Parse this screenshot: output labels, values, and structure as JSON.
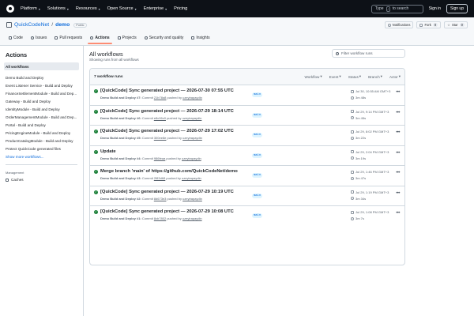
{
  "header": {
    "nav": [
      "Platform",
      "Solutions",
      "Resources",
      "Open Source",
      "Enterprise",
      "Pricing"
    ],
    "search_text": "Type",
    "search_kbd": "/",
    "search_suffix": "to search",
    "sign_in": "Sign in",
    "sign_up": "Sign up"
  },
  "repo": {
    "owner": "QuickCodeNet",
    "separator": "/",
    "name": "demo",
    "visibility": "Public",
    "notifications": "Notifications",
    "fork_label": "Fork",
    "fork_count": "0",
    "star_label": "Star",
    "star_count": "0",
    "tabs": [
      "Code",
      "Issues",
      "Pull requests",
      "Actions",
      "Projects",
      "Security and quality",
      "Insights"
    ]
  },
  "sidebar": {
    "title": "Actions",
    "all_workflows": "All workflows",
    "workflows": [
      "Demo Build and Deploy",
      "Event Listener Service - Build and Deploy",
      "FinanceSettlementModule - Build and Dep...",
      "Gateway - Build and Deploy",
      "IdentityModule - Build and Deploy",
      "OrderManagementModule - Build and Dep...",
      "Portal - Build and Deploy",
      "PricingEngineModule - Build and Deploy",
      "ProductCatalogModule - Build and Deploy",
      "Protect QuickCode generated files"
    ],
    "show_more": "Show more workflows...",
    "management_title": "Management",
    "caches": "Caches"
  },
  "main": {
    "title": "All workflows",
    "subtitle": "Showing runs from all workflows",
    "filter_placeholder": "Filter workflow runs",
    "runs_count": "7 workflow runs",
    "filters": [
      "Workflow",
      "Event",
      "Status",
      "Branch",
      "Actor"
    ],
    "runs": [
      {
        "title": "[QuickCode] Sync generated project — 2026-07-30 07:55 UTC",
        "workflow": "Demo Build and Deploy #7:",
        "commit_prefix": "Commit",
        "commit": "21b78a8",
        "pushed_by": "pushed by",
        "actor": "uzeyirapaydin",
        "branch": "main",
        "time": "Jul 30, 10:55 AM GMT+3",
        "duration": "3m 48s"
      },
      {
        "title": "[QuickCode] Sync generated project — 2026-07-29 18:14 UTC",
        "workflow": "Demo Build and Deploy #6:",
        "commit_prefix": "Commit",
        "commit": "e8c06c0",
        "pushed_by": "pushed by",
        "actor": "uzeyirapaydin",
        "branch": "main",
        "time": "Jul 29, 9:14 PM GMT+3",
        "duration": "3m 45s"
      },
      {
        "title": "[QuickCode] Sync generated project — 2026-07-29 17:02 UTC",
        "workflow": "Demo Build and Deploy #5:",
        "commit_prefix": "Commit",
        "commit": "300ee8e",
        "pushed_by": "pushed by",
        "actor": "uzeyirapaydin",
        "branch": "main",
        "time": "Jul 29, 8:02 PM GMT+3",
        "duration": "3m 22s"
      },
      {
        "title": "Update",
        "workflow": "Demo Build and Deploy #4:",
        "commit_prefix": "Commit",
        "commit": "986feaa",
        "pushed_by": "pushed by",
        "actor": "uzeyirapaydin",
        "branch": "main",
        "time": "Jul 29, 2:04 PM GMT+3",
        "duration": "3m 19s"
      },
      {
        "title": "Merge branch 'main' of https://github.com/QuickCodeNet/demo",
        "workflow": "Demo Build and Deploy #3:",
        "commit_prefix": "Commit",
        "commit": "2f83d68",
        "pushed_by": "pushed by",
        "actor": "uzeyirapaydin",
        "branch": "main",
        "time": "Jul 29, 1:46 PM GMT+3",
        "duration": "3m 47s"
      },
      {
        "title": "[QuickCode] Sync generated project — 2026-07-29 10:19 UTC",
        "workflow": "Demo Build and Deploy #2:",
        "commit_prefix": "Commit",
        "commit": "8d673e3",
        "pushed_by": "pushed by",
        "actor": "uzeyirapaydin",
        "branch": "main",
        "time": "Jul 29, 1:19 PM GMT+3",
        "duration": "3m 34s"
      },
      {
        "title": "[QuickCode] Sync generated project — 2026-07-29 10:08 UTC",
        "workflow": "Demo Build and Deploy #1:",
        "commit_prefix": "Commit",
        "commit": "8cb7802",
        "pushed_by": "pushed by",
        "actor": "uzeyirapaydin",
        "branch": "main",
        "time": "Jul 29, 1:08 PM GMT+3",
        "duration": "3m 7s"
      }
    ]
  }
}
